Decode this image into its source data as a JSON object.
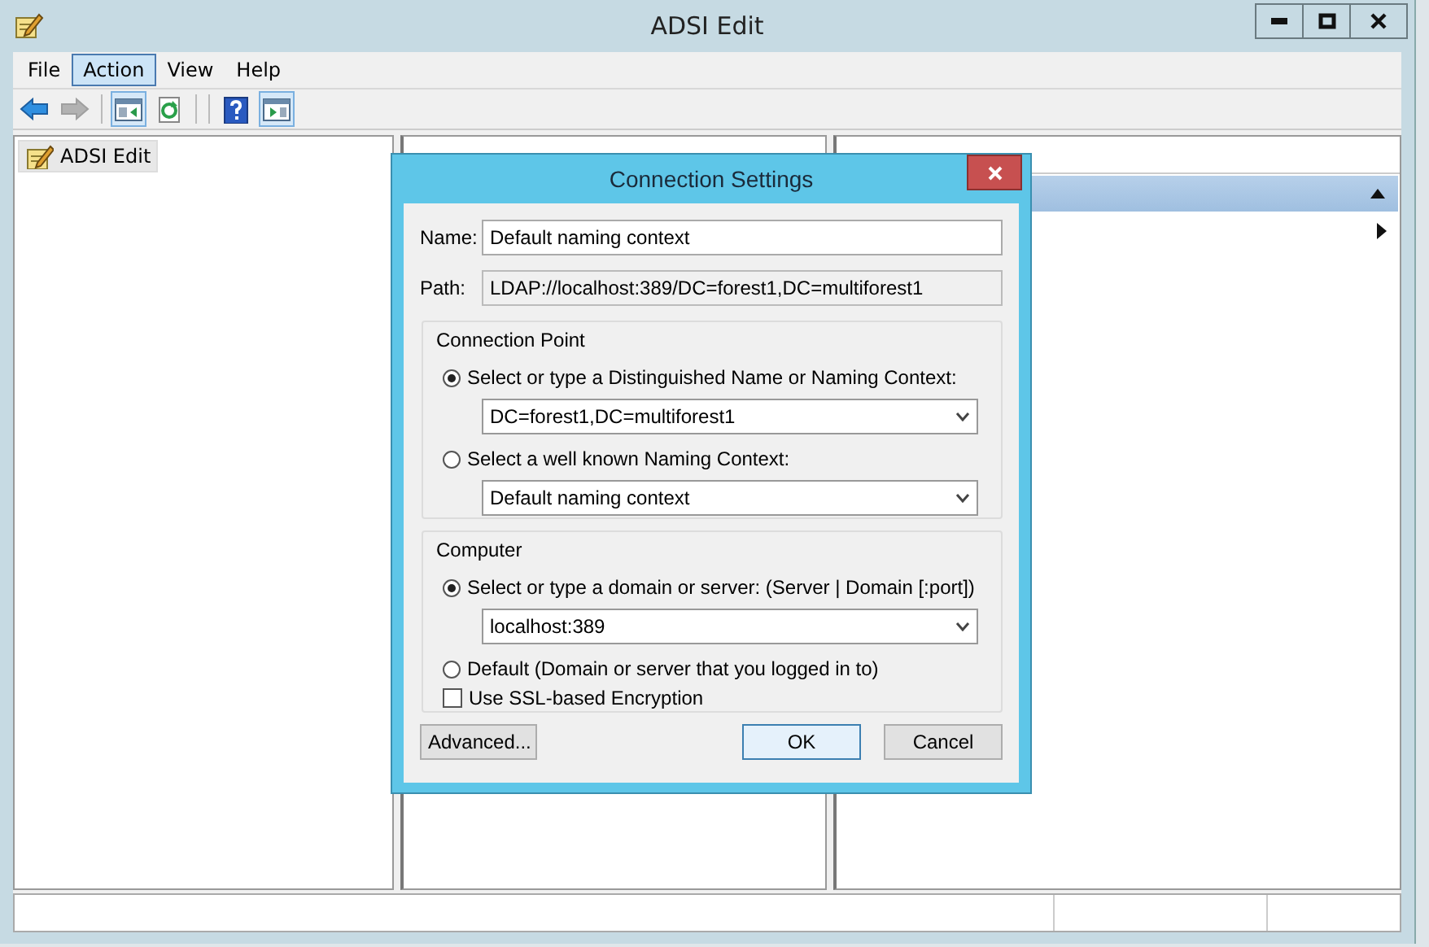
{
  "window": {
    "title": "ADSI Edit"
  },
  "menu": [
    {
      "label": "File",
      "selected": false
    },
    {
      "label": "Action",
      "selected": true
    },
    {
      "label": "View",
      "selected": false
    },
    {
      "label": "Help",
      "selected": false
    }
  ],
  "toolbar": [
    {
      "kind": "back",
      "disabled": false,
      "pressed": false
    },
    {
      "kind": "forward",
      "disabled": true,
      "pressed": false
    },
    {
      "kind": "tree",
      "disabled": false,
      "pressed": true
    },
    {
      "kind": "refresh",
      "disabled": false,
      "pressed": false
    },
    {
      "kind": "help",
      "disabled": false,
      "pressed": false
    },
    {
      "kind": "actionpane",
      "disabled": false,
      "pressed": true
    }
  ],
  "tree": [
    {
      "label": "ADSI Edit",
      "selected": true
    }
  ],
  "dialog": {
    "title": "Connection Settings",
    "name_label": "Name:",
    "name_value": "Default naming context",
    "path_label": "Path:",
    "path_value": "LDAP://localhost:389/DC=forest1,DC=multiforest1",
    "connection_point": {
      "title": "Connection Point",
      "options": [
        {
          "label": "Select or type a Distinguished Name or Naming Context:",
          "selected": true,
          "value": "DC=forest1,DC=multiforest1"
        },
        {
          "label": "Select a well known Naming Context:",
          "selected": false,
          "value": "Default naming context"
        }
      ]
    },
    "computer": {
      "title": "Computer",
      "options": [
        {
          "label": "Select or type a domain or server: (Server | Domain [:port])",
          "selected": true,
          "value": "localhost:389"
        },
        {
          "label": "Default (Domain or server that you logged in to)",
          "selected": false
        }
      ],
      "ssl": {
        "label": "Use SSL-based Encryption",
        "checked": false
      }
    },
    "buttons": [
      {
        "label": "Advanced...",
        "default": false
      },
      {
        "label": "OK",
        "default": true
      },
      {
        "label": "Cancel",
        "default": false
      }
    ]
  }
}
